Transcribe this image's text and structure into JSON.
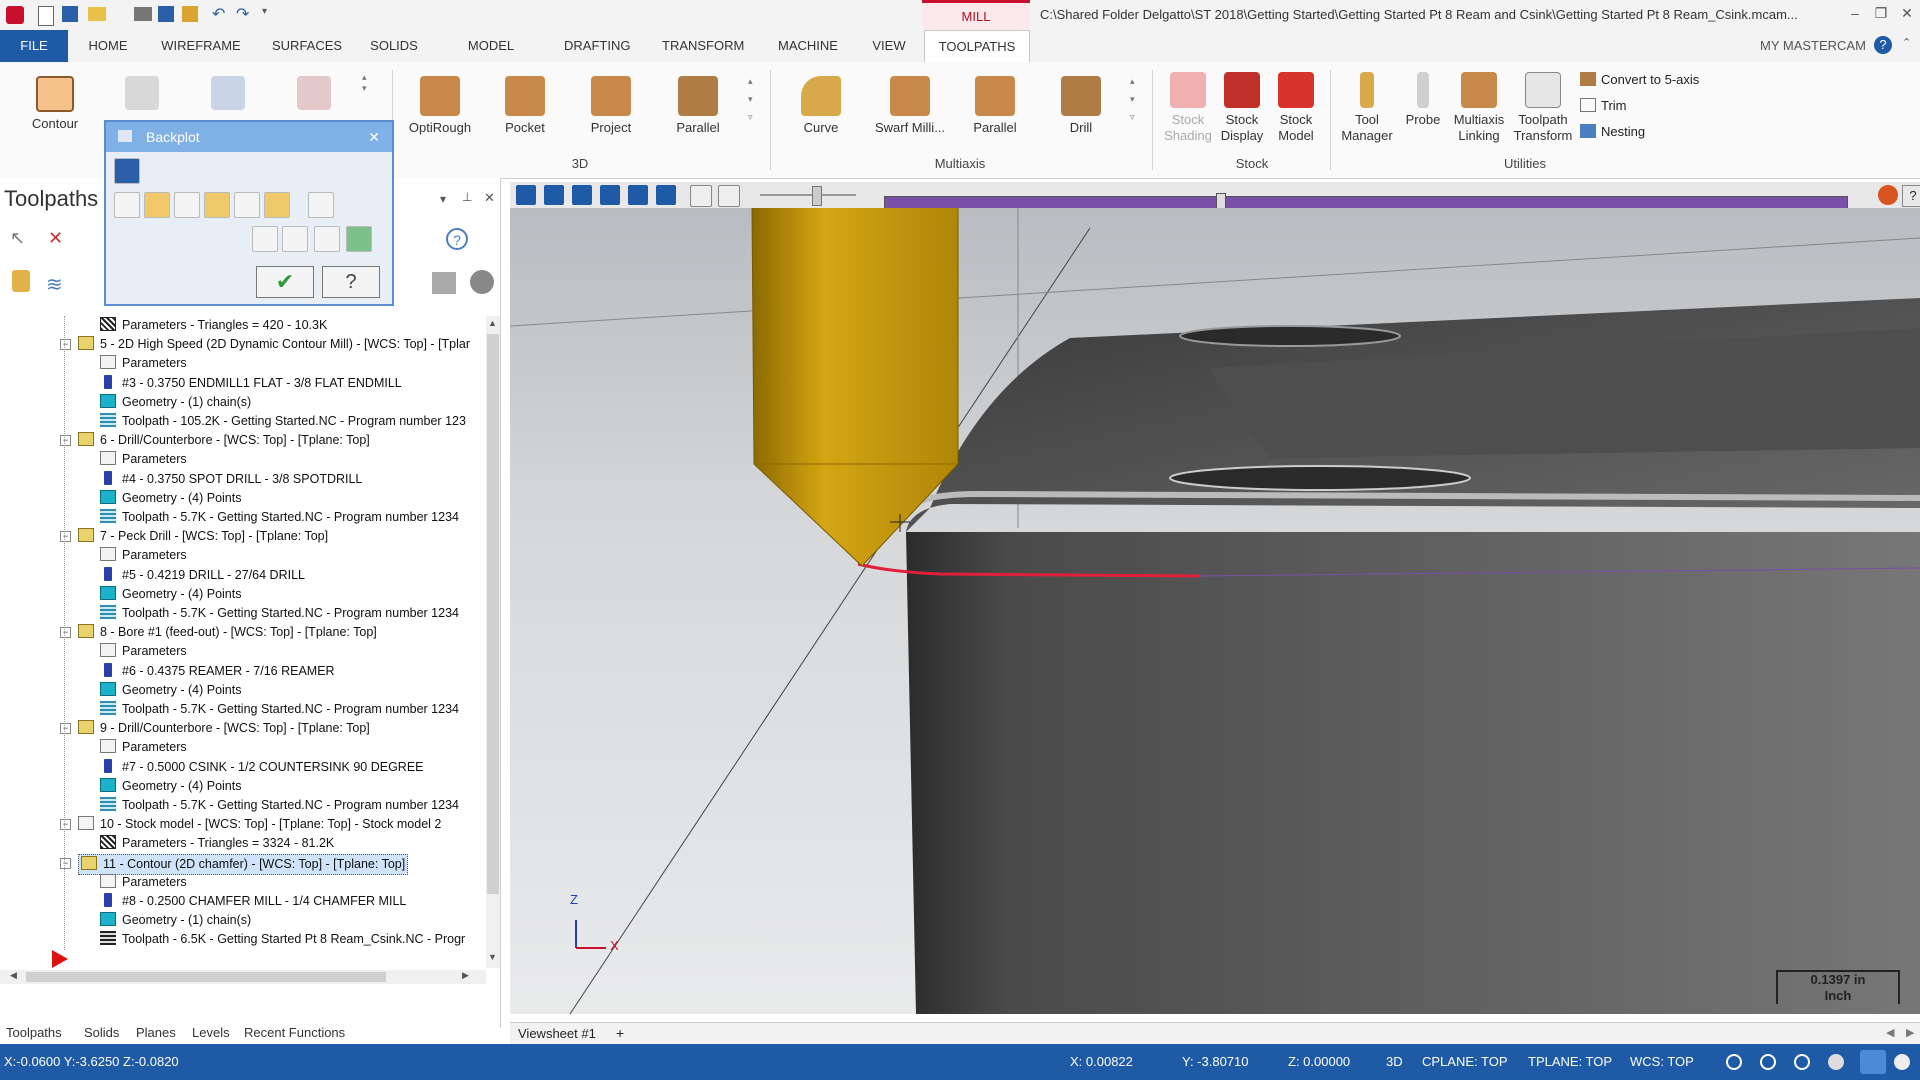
{
  "window": {
    "context_tab": "MILL",
    "file_path": "C:\\Shared Folder Delgatto\\ST 2018\\Getting Started\\Getting Started Pt 8 Ream and Csink\\Getting Started Pt 8 Ream_Csink.mcam...",
    "account_label": "MY MASTERCAM"
  },
  "tabs": [
    "FILE",
    "HOME",
    "WIREFRAME",
    "SURFACES",
    "SOLIDS",
    "MODEL PREP",
    "DRAFTING",
    "TRANSFORM",
    "MACHINE",
    "VIEW",
    "TOOLPATHS"
  ],
  "ribbon": {
    "contour_label": "Contour",
    "tools_3d": [
      "OptiRough",
      "Pocket",
      "Project",
      "Parallel"
    ],
    "group_3d": "3D",
    "multiaxis": [
      "Curve",
      "Swarf Milli...",
      "Parallel",
      "Drill"
    ],
    "group_multiaxis": "Multiaxis",
    "stock_shading": [
      "Stock",
      "Shading"
    ],
    "stock_display": [
      "Stock",
      "Display"
    ],
    "stock_model": [
      "Stock",
      "Model"
    ],
    "group_stock": "Stock",
    "tool_manager": [
      "Tool",
      "Manager"
    ],
    "probe": "Probe",
    "multiaxis_linking": [
      "Multiaxis",
      "Linking"
    ],
    "toolpath_transform": [
      "Toolpath",
      "Transform"
    ],
    "convert_5axis": "Convert to 5-axis",
    "trim": "Trim",
    "nesting": "Nesting",
    "group_utilities": "Utilities"
  },
  "backplot": {
    "title": "Backplot"
  },
  "panel": {
    "title": "Toolpaths"
  },
  "tree": [
    {
      "text": "Parameters - Triangles = 420 - 10.3K",
      "icon": "hatch",
      "level": 2
    },
    {
      "text": "5 - 2D High Speed (2D Dynamic Contour Mill) - [WCS: Top] - [Tplar",
      "icon": "folder",
      "level": 1
    },
    {
      "text": "Parameters",
      "icon": "folderw",
      "level": 2
    },
    {
      "text": "#3 - 0.3750 ENDMILL1 FLAT - 3/8 FLAT ENDMILL",
      "icon": "tool",
      "level": 2
    },
    {
      "text": "Geometry - (1) chain(s)",
      "icon": "geom",
      "level": 2
    },
    {
      "text": "Toolpath - 105.2K - Getting Started.NC - Program number 123",
      "icon": "tpath",
      "level": 2
    },
    {
      "text": "6 - Drill/Counterbore - [WCS: Top] - [Tplane: Top]",
      "icon": "folder",
      "level": 1
    },
    {
      "text": "Parameters",
      "icon": "folderw",
      "level": 2
    },
    {
      "text": "#4 - 0.3750 SPOT DRILL - 3/8 SPOTDRILL",
      "icon": "tool",
      "level": 2
    },
    {
      "text": "Geometry - (4) Points",
      "icon": "geom",
      "level": 2
    },
    {
      "text": "Toolpath - 5.7K - Getting Started.NC - Program number 1234",
      "icon": "tpath",
      "level": 2
    },
    {
      "text": "7 - Peck Drill - [WCS: Top] - [Tplane: Top]",
      "icon": "folder",
      "level": 1
    },
    {
      "text": "Parameters",
      "icon": "folderw",
      "level": 2
    },
    {
      "text": "#5 - 0.4219 DRILL - 27/64 DRILL",
      "icon": "tool",
      "level": 2
    },
    {
      "text": "Geometry - (4) Points",
      "icon": "geom",
      "level": 2
    },
    {
      "text": "Toolpath - 5.7K - Getting Started.NC - Program number 1234",
      "icon": "tpath",
      "level": 2
    },
    {
      "text": "8 - Bore #1 (feed-out) - [WCS: Top] - [Tplane: Top]",
      "icon": "folder",
      "level": 1
    },
    {
      "text": "Parameters",
      "icon": "folderw",
      "level": 2
    },
    {
      "text": "#6 - 0.4375 REAMER - 7/16 REAMER",
      "icon": "tool",
      "level": 2
    },
    {
      "text": "Geometry - (4) Points",
      "icon": "geom",
      "level": 2
    },
    {
      "text": "Toolpath - 5.7K - Getting Started.NC - Program number 1234",
      "icon": "tpath",
      "level": 2
    },
    {
      "text": "9 - Drill/Counterbore - [WCS: Top] - [Tplane: Top]",
      "icon": "folder",
      "level": 1
    },
    {
      "text": "Parameters",
      "icon": "folderw",
      "level": 2
    },
    {
      "text": "#7 - 0.5000 CSINK - 1/2 COUNTERSINK 90 DEGREE",
      "icon": "tool",
      "level": 2
    },
    {
      "text": "Geometry - (4) Points",
      "icon": "geom",
      "level": 2
    },
    {
      "text": "Toolpath - 5.7K - Getting Started.NC - Program number 1234",
      "icon": "tpath",
      "level": 2
    },
    {
      "text": "10 - Stock model - [WCS: Top] - [Tplane: Top] - Stock model 2",
      "icon": "folderw",
      "level": 1
    },
    {
      "text": "Parameters - Triangles = 3324 - 81.2K",
      "icon": "hatch",
      "level": 2
    },
    {
      "text": "11 - Contour (2D chamfer) - [WCS: Top] - [Tplane: Top]",
      "icon": "folder",
      "level": 1,
      "selected": true
    },
    {
      "text": "Parameters",
      "icon": "folderw",
      "level": 2
    },
    {
      "text": "#8 - 0.2500 CHAMFER MILL - 1/4 CHAMFER MILL",
      "icon": "tool",
      "level": 2
    },
    {
      "text": "Geometry - (1) chain(s)",
      "icon": "geom",
      "level": 2
    },
    {
      "text": "Toolpath - 6.5K - Getting Started Pt 8 Ream_Csink.NC - Progr",
      "icon": "tpathb",
      "level": 2
    }
  ],
  "bottom_tabs": [
    "Toolpaths",
    "Solids",
    "Planes",
    "Levels",
    "Recent Functions"
  ],
  "viewsheet": {
    "tab": "Viewsheet #1",
    "add": "+"
  },
  "viewport": {
    "axis_z": "Z",
    "axis_x": "X",
    "scale_value": "0.1397 in",
    "scale_unit": "Inch"
  },
  "status": {
    "left_coords": "X:-0.0600  Y:-3.6250  Z:-0.0820",
    "x": "X:   0.00822",
    "y": "Y:   -3.80710",
    "z": "Z:   0.00000",
    "mode": "3D",
    "cplane": "CPLANE: TOP",
    "tplane": "TPLANE: TOP",
    "wcs": "WCS: TOP"
  },
  "colors": {
    "accent": "#1f5aa6",
    "mill_tab": "#c8102e",
    "tool_yellow": "#d4a514",
    "toolpath_red": "#e0203a"
  }
}
